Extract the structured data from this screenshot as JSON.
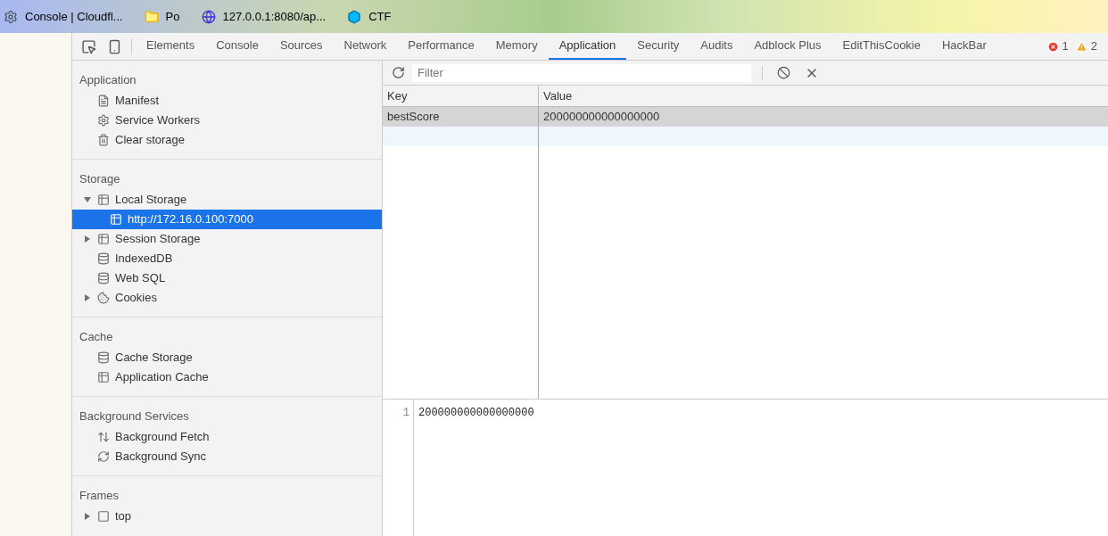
{
  "bookmarks": [
    {
      "kind": "gear",
      "label": "Console | Cloudfl..."
    },
    {
      "kind": "folder",
      "label": "Po"
    },
    {
      "kind": "globe",
      "label": "127.0.0.1:8080/ap..."
    },
    {
      "kind": "logo",
      "label": "CTF"
    }
  ],
  "tabs": [
    {
      "label": "Elements",
      "selected": false
    },
    {
      "label": "Console",
      "selected": false
    },
    {
      "label": "Sources",
      "selected": false
    },
    {
      "label": "Network",
      "selected": false
    },
    {
      "label": "Performance",
      "selected": false
    },
    {
      "label": "Memory",
      "selected": false
    },
    {
      "label": "Application",
      "selected": true
    },
    {
      "label": "Security",
      "selected": false
    },
    {
      "label": "Audits",
      "selected": false
    },
    {
      "label": "Adblock Plus",
      "selected": false
    },
    {
      "label": "EditThisCookie",
      "selected": false
    },
    {
      "label": "HackBar",
      "selected": false
    }
  ],
  "errors": "1",
  "warnings": "2",
  "sidebar": [
    {
      "title": "Application",
      "items": [
        {
          "kind": "file",
          "label": "Manifest",
          "selected": false
        },
        {
          "kind": "gear",
          "label": "Service Workers",
          "selected": false
        },
        {
          "kind": "trash",
          "label": "Clear storage",
          "selected": false
        }
      ]
    },
    {
      "title": "Storage",
      "items": [
        {
          "kind": "grid",
          "label": "Local Storage",
          "selected": false,
          "expanded": true,
          "children": [
            {
              "kind": "grid",
              "label": "http://172.16.0.100:7000",
              "selected": true
            }
          ]
        },
        {
          "kind": "grid",
          "label": "Session Storage",
          "selected": false,
          "expanded": false
        },
        {
          "kind": "database",
          "label": "IndexedDB",
          "selected": false
        },
        {
          "kind": "database",
          "label": "Web SQL",
          "selected": false
        },
        {
          "kind": "cookie",
          "label": "Cookies",
          "selected": false,
          "expanded": false
        }
      ]
    },
    {
      "title": "Cache",
      "items": [
        {
          "kind": "database",
          "label": "Cache Storage",
          "selected": false
        },
        {
          "kind": "grid",
          "label": "Application Cache",
          "selected": false
        }
      ]
    },
    {
      "title": "Background Services",
      "items": [
        {
          "kind": "arrows",
          "label": "Background Fetch",
          "selected": false
        },
        {
          "kind": "sync",
          "label": "Background Sync",
          "selected": false
        }
      ]
    },
    {
      "title": "Frames",
      "items": [
        {
          "kind": "frame",
          "label": "top",
          "selected": false,
          "expanded": false
        }
      ]
    }
  ],
  "filter": {
    "placeholder": "Filter"
  },
  "table": {
    "columns": [
      "Key",
      "Value"
    ],
    "rows": [
      {
        "cells": [
          "bestScore",
          "200000000000000000"
        ],
        "selected": true
      }
    ]
  },
  "preview": {
    "lines": [
      {
        "number": "1",
        "text": "200000000000000000"
      }
    ]
  }
}
